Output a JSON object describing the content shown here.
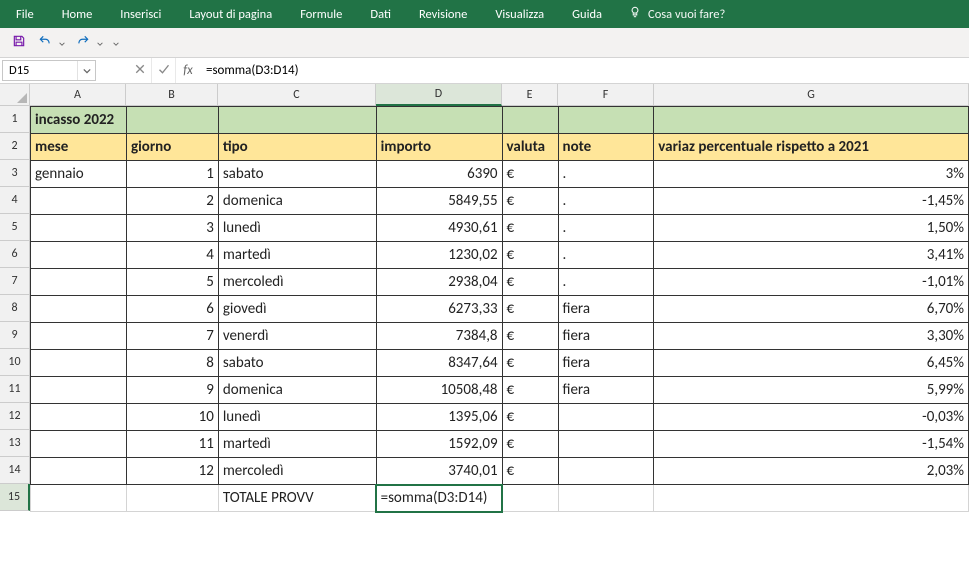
{
  "ribbon": {
    "tabs": [
      "File",
      "Home",
      "Inserisci",
      "Layout di pagina",
      "Formule",
      "Dati",
      "Revisione",
      "Visualizza",
      "Guida"
    ],
    "tell_me": "Cosa vuoi fare?"
  },
  "quick_access": {
    "save": "Salva",
    "undo": "Annulla",
    "redo": "Ripristina",
    "customize": "Personalizza"
  },
  "namebox": {
    "value": "D15"
  },
  "formula_bar": {
    "fx": "fx",
    "value": "=somma(D3:D14)"
  },
  "columns": [
    "A",
    "B",
    "C",
    "D",
    "E",
    "F",
    "G"
  ],
  "rows": [
    "1",
    "2",
    "3",
    "4",
    "5",
    "6",
    "7",
    "8",
    "9",
    "10",
    "11",
    "12",
    "13",
    "14",
    "15"
  ],
  "data": {
    "r1": {
      "A": "incasso 2022"
    },
    "r2": {
      "A": "mese",
      "B": "giorno",
      "C": "tipo",
      "D": "importo",
      "E": "valuta",
      "F": "note",
      "G": "variaz percentuale rispetto a 2021"
    },
    "body": [
      {
        "A": "gennaio",
        "B": "1",
        "C": "sabato",
        "D": "6390",
        "E": "€",
        "F": ".",
        "G": "3%"
      },
      {
        "A": "",
        "B": "2",
        "C": "domenica",
        "D": "5849,55",
        "E": "€",
        "F": ".",
        "G": "-1,45%"
      },
      {
        "A": "",
        "B": "3",
        "C": "lunedì",
        "D": "4930,61",
        "E": "€",
        "F": ".",
        "G": "1,50%"
      },
      {
        "A": "",
        "B": "4",
        "C": "martedì",
        "D": "1230,02",
        "E": "€",
        "F": ".",
        "G": "3,41%"
      },
      {
        "A": "",
        "B": "5",
        "C": "mercoledì",
        "D": "2938,04",
        "E": "€",
        "F": ".",
        "G": "-1,01%"
      },
      {
        "A": "",
        "B": "6",
        "C": "giovedì",
        "D": "6273,33",
        "E": "€",
        "F": "fiera",
        "G": "6,70%"
      },
      {
        "A": "",
        "B": "7",
        "C": "venerdì",
        "D": "7384,8",
        "E": "€",
        "F": "fiera",
        "G": "3,30%"
      },
      {
        "A": "",
        "B": "8",
        "C": "sabato",
        "D": "8347,64",
        "E": "€",
        "F": "fiera",
        "G": "6,45%"
      },
      {
        "A": "",
        "B": "9",
        "C": "domenica",
        "D": "10508,48",
        "E": "€",
        "F": "fiera",
        "G": "5,99%"
      },
      {
        "A": "",
        "B": "10",
        "C": "lunedì",
        "D": "1395,06",
        "E": "€",
        "F": "",
        "G": "-0,03%"
      },
      {
        "A": "",
        "B": "11",
        "C": "martedì",
        "D": "1592,09",
        "E": "€",
        "F": "",
        "G": "-1,54%"
      },
      {
        "A": "",
        "B": "12",
        "C": "mercoledì",
        "D": "3740,01",
        "E": "€",
        "F": "",
        "G": "2,03%"
      }
    ],
    "r15": {
      "C": "TOTALE PROVV",
      "D": "=somma(D3:D14)"
    }
  },
  "colors": {
    "ribbon": "#217346",
    "green_fill": "#C6E0B4",
    "yellow_fill": "#FFE699"
  },
  "active_cell": {
    "col": "D",
    "row": "15"
  }
}
